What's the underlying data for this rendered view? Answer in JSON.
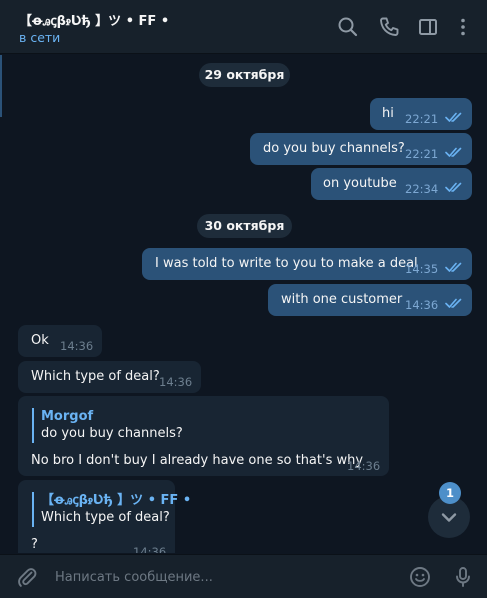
{
  "header": {
    "title": "【ꝋꭿꞔβꭾƲђ 】ツ • FF •",
    "status": "в сети"
  },
  "icons": {
    "search": "search-icon",
    "call": "phone-icon",
    "sidebar": "sidebar-panel-icon",
    "menu": "more-vertical-icon",
    "attach": "paperclip-icon",
    "emoji": "emoji-icon",
    "mic": "microphone-icon",
    "scroll": "chevron-down-icon"
  },
  "dates": [
    "29 октября",
    "30 октября"
  ],
  "messages": [
    {
      "dir": "out",
      "text": "hi",
      "time": "22:21",
      "status": "read"
    },
    {
      "dir": "out",
      "text": "do you buy channels?",
      "time": "22:21",
      "status": "read"
    },
    {
      "dir": "out",
      "text": "on youtube",
      "time": "22:34",
      "status": "read"
    },
    {
      "dir": "out",
      "text": "I was told to write to you to make a deal",
      "time": "14:35",
      "status": "read"
    },
    {
      "dir": "out",
      "text": "with one customer",
      "time": "14:36",
      "status": "read"
    },
    {
      "dir": "in",
      "text": "Ok",
      "time": "14:36"
    },
    {
      "dir": "in",
      "text": "Which type of deal?",
      "time": "14:36"
    },
    {
      "dir": "in",
      "reply_name": "Morgof",
      "reply_text": "do you buy channels?",
      "text": "No bro I don't buy I already have one so that's why",
      "time": "14:36"
    },
    {
      "dir": "in",
      "reply_name": "【ꝋꭿꞔβꭾƲђ 】ツ • FF •",
      "reply_text": "Which type of deal?",
      "text": "?",
      "time": "14:36"
    }
  ],
  "composer": {
    "placeholder": "Написать сообщение..."
  },
  "unread_count": "1",
  "colors": {
    "background": "#0e1621",
    "header": "#17212b",
    "outgoing_bubble": "#2b5278",
    "incoming_bubble": "#182533",
    "accent": "#6ab3f3"
  }
}
